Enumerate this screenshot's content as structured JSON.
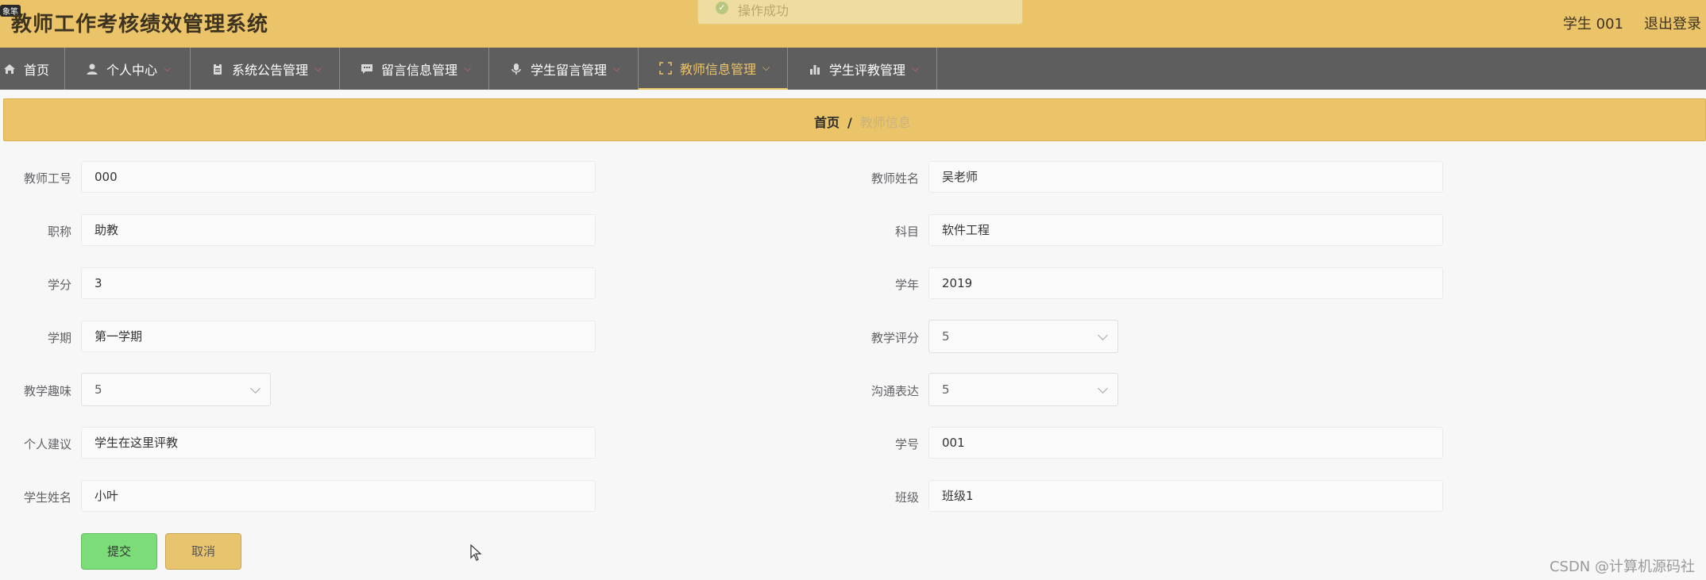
{
  "header": {
    "badge": "象笔",
    "title": "教师工作考核绩效管理系统",
    "user": "学生 001",
    "logout": "退出登录"
  },
  "toast": {
    "message": "操作成功"
  },
  "nav": {
    "items": [
      {
        "label": "首页",
        "icon": "home-icon"
      },
      {
        "label": "个人中心",
        "icon": "user-icon"
      },
      {
        "label": "系统公告管理",
        "icon": "clipboard-icon"
      },
      {
        "label": "留言信息管理",
        "icon": "message-icon"
      },
      {
        "label": "学生留言管理",
        "icon": "microphone-icon"
      },
      {
        "label": "教师信息管理",
        "icon": "expand-icon",
        "active": true
      },
      {
        "label": "学生评教管理",
        "icon": "bar-chart-icon"
      }
    ]
  },
  "breadcrumb": {
    "home": "首页",
    "separator": "/",
    "current": "教师信息"
  },
  "form": {
    "teacher_id": {
      "label": "教师工号",
      "value": "000"
    },
    "teacher_name": {
      "label": "教师姓名",
      "value": "吴老师"
    },
    "title": {
      "label": "职称",
      "value": "助教"
    },
    "subject": {
      "label": "科目",
      "value": "软件工程"
    },
    "credit": {
      "label": "学分",
      "value": "3"
    },
    "school_year": {
      "label": "学年",
      "value": "2019"
    },
    "semester": {
      "label": "学期",
      "value": "第一学期"
    },
    "teaching_score": {
      "label": "教学评分",
      "value": "5"
    },
    "teaching_interest": {
      "label": "教学趣味",
      "value": "5"
    },
    "communication": {
      "label": "沟通表达",
      "value": "5"
    },
    "suggestion": {
      "label": "个人建议",
      "value": "学生在这里评教"
    },
    "student_id": {
      "label": "学号",
      "value": "001"
    },
    "student_name": {
      "label": "学生姓名",
      "value": "小叶"
    },
    "class": {
      "label": "班级",
      "value": "班级1"
    },
    "submit": "提交",
    "cancel": "取消"
  },
  "watermark": "CSDN @计算机源码社",
  "colors": {
    "header": "#ebc46a",
    "nav": "#5f5e5e",
    "submit": "#7ddc7a",
    "cancel": "#e8c46e"
  }
}
